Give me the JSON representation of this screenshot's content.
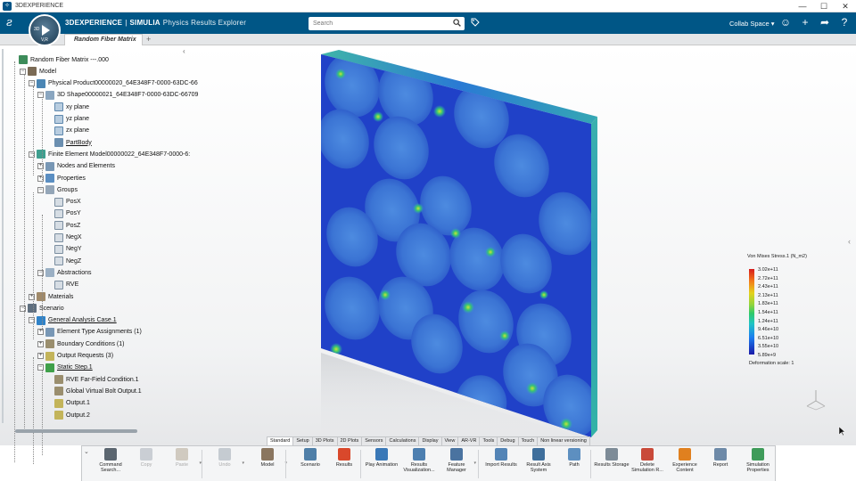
{
  "window": {
    "title": "3DEXPERIENCE",
    "controls": [
      "—",
      "☐",
      "✕"
    ]
  },
  "topbar": {
    "compass_label": "3D",
    "compass_version": "V,R",
    "brand_main": "3DEXPERIENCE",
    "brand_sep": "|",
    "brand_company": "SIMULIA",
    "brand_app": "Physics Results Explorer",
    "search_placeholder": "Search",
    "collab_space": "Collab Space",
    "icons": [
      "user-icon",
      "add-icon",
      "share-icon",
      "help-icon"
    ]
  },
  "tabs": {
    "active": "Random Fiber Matrix",
    "add": "+"
  },
  "tree": {
    "nodes": [
      {
        "label": "Random Fiber Matrix ---.000",
        "indent": 0,
        "icon": "ic-root",
        "toggle": ""
      },
      {
        "label": "Model",
        "indent": 1,
        "icon": "ic-box",
        "toggle": "−"
      },
      {
        "label": "Physical Product00000020_64E348F7-0000-63DC-66",
        "indent": 2,
        "icon": "ic-prod",
        "toggle": "−"
      },
      {
        "label": "3D Shape00000021_64E348F7-0000-63DC-66709",
        "indent": 3,
        "icon": "ic-shape",
        "toggle": "−"
      },
      {
        "label": "xy plane",
        "indent": 4,
        "icon": "ic-plane",
        "toggle": ""
      },
      {
        "label": "yz plane",
        "indent": 4,
        "icon": "ic-plane",
        "toggle": ""
      },
      {
        "label": "zx plane",
        "indent": 4,
        "icon": "ic-plane",
        "toggle": ""
      },
      {
        "label": "PartBody",
        "indent": 4,
        "icon": "ic-part",
        "toggle": "",
        "underline": true
      },
      {
        "label": "Finite Element Model00000022_64E348F7-0000-6:",
        "indent": 2,
        "icon": "ic-fem",
        "toggle": "−"
      },
      {
        "label": "Nodes and Elements",
        "indent": 3,
        "icon": "ic-nodes",
        "toggle": "+"
      },
      {
        "label": "Properties",
        "indent": 3,
        "icon": "ic-prop",
        "toggle": "+"
      },
      {
        "label": "Groups",
        "indent": 3,
        "icon": "ic-group",
        "toggle": "−"
      },
      {
        "label": "PosX",
        "indent": 4,
        "icon": "ic-sub",
        "toggle": ""
      },
      {
        "label": "PosY",
        "indent": 4,
        "icon": "ic-sub",
        "toggle": ""
      },
      {
        "label": "PosZ",
        "indent": 4,
        "icon": "ic-sub",
        "toggle": ""
      },
      {
        "label": "NegX",
        "indent": 4,
        "icon": "ic-sub",
        "toggle": ""
      },
      {
        "label": "NegY",
        "indent": 4,
        "icon": "ic-sub",
        "toggle": ""
      },
      {
        "label": "NegZ",
        "indent": 4,
        "icon": "ic-sub",
        "toggle": ""
      },
      {
        "label": "Abstractions",
        "indent": 3,
        "icon": "ic-abs",
        "toggle": "−"
      },
      {
        "label": "RVE",
        "indent": 4,
        "icon": "ic-sub",
        "toggle": ""
      },
      {
        "label": "Materials",
        "indent": 2,
        "icon": "ic-mat",
        "toggle": "+"
      },
      {
        "label": "Scenario",
        "indent": 1,
        "icon": "ic-scen",
        "toggle": "−"
      },
      {
        "label": "General Analysis Case.1",
        "indent": 2,
        "icon": "ic-case",
        "toggle": "−",
        "underline": true
      },
      {
        "label": "Element Type Assignments (1)",
        "indent": 3,
        "icon": "ic-nodes",
        "toggle": "+"
      },
      {
        "label": "Boundary Conditions (1)",
        "indent": 3,
        "icon": "ic-bc",
        "toggle": "+"
      },
      {
        "label": "Output Requests (3)",
        "indent": 3,
        "icon": "ic-out",
        "toggle": "+"
      },
      {
        "label": "Static Step.1",
        "indent": 3,
        "icon": "ic-step",
        "toggle": "−",
        "underline": true
      },
      {
        "label": "RVE Far-Field Condition.1",
        "indent": 4,
        "icon": "ic-bc",
        "toggle": ""
      },
      {
        "label": "Global Virtual Bolt Output.1",
        "indent": 4,
        "icon": "ic-bc",
        "toggle": ""
      },
      {
        "label": "Output.1",
        "indent": 4,
        "icon": "ic-out",
        "toggle": ""
      },
      {
        "label": "Output.2",
        "indent": 4,
        "icon": "ic-out",
        "toggle": ""
      }
    ]
  },
  "legend": {
    "title": "Von Mises Stress.1 (N_m2)",
    "labels": [
      "3.02e+11",
      "2.72e+11",
      "2.43e+11",
      "2.13e+11",
      "1.83e+11",
      "1.54e+11",
      "1.24e+11",
      "9.46e+10",
      "6.51e+10",
      "3.55e+10",
      "5.89e+9"
    ],
    "deformation": "Deformation scale: 1"
  },
  "section_tabs": [
    "Standard",
    "Setup",
    "3D Plots",
    "2D Plots",
    "Sensors",
    "Calculations",
    "Display",
    "View",
    "AR-VR",
    "Tools",
    "Debug",
    "Touch",
    "Non linear versioning"
  ],
  "section_active": "Standard",
  "actions": [
    {
      "label": "Command Search...",
      "icon": "search-icon",
      "color": "#5b6670",
      "disabled": false
    },
    {
      "label": "Copy",
      "icon": "copy-icon",
      "color": "#7b8794",
      "disabled": true
    },
    {
      "label": "Paste",
      "icon": "paste-icon",
      "color": "#8c7a5d",
      "disabled": true,
      "drop": true
    },
    {
      "label": "Undo",
      "icon": "undo-icon",
      "color": "#6e7d8c",
      "disabled": true,
      "drop": true
    },
    {
      "label": "Model",
      "icon": "model-icon",
      "color": "#8a7660",
      "disabled": false,
      "drop": true
    },
    {
      "label": "Scenario",
      "icon": "scenario-icon",
      "color": "#4f7fa8",
      "disabled": false
    },
    {
      "label": "Results",
      "icon": "results-icon",
      "color": "#d9482b",
      "disabled": false
    },
    {
      "label": "Play Animation",
      "icon": "play-animation-icon",
      "color": "#3a78b7",
      "disabled": false
    },
    {
      "label": "Results Visualization...",
      "icon": "results-visualization-icon",
      "color": "#4d7fb0",
      "disabled": false
    },
    {
      "label": "Feature Manager",
      "icon": "feature-manager-icon",
      "color": "#4a73a0",
      "disabled": false,
      "drop": true
    },
    {
      "label": "Import Results",
      "icon": "import-results-icon",
      "color": "#5384b6",
      "disabled": false
    },
    {
      "label": "Result Axis System",
      "icon": "axis-system-icon",
      "color": "#3f6f9c",
      "disabled": false
    },
    {
      "label": "Path",
      "icon": "path-icon",
      "color": "#5d8fc0",
      "disabled": false
    },
    {
      "label": "Results Storage",
      "icon": "results-storage-icon",
      "color": "#7d8b97",
      "disabled": false
    },
    {
      "label": "Delete Simulation R...",
      "icon": "delete-simulation-icon",
      "color": "#c94a3a",
      "disabled": false
    },
    {
      "label": "Experience Content",
      "icon": "experience-content-icon",
      "color": "#e0801f",
      "disabled": false
    },
    {
      "label": "Report",
      "icon": "report-icon",
      "color": "#6e8aa8",
      "disabled": false
    },
    {
      "label": "Simulation Properties",
      "icon": "simulation-properties-icon",
      "color": "#3f9b5a",
      "disabled": false
    }
  ],
  "colors": {
    "topbar": "#005686",
    "plate_base": "#1f3fc4",
    "plate_fiber": "#3e7fd8"
  }
}
